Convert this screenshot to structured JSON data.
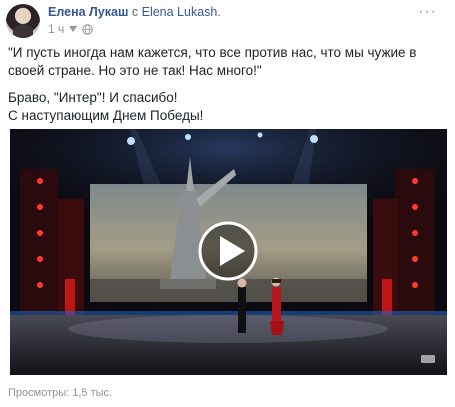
{
  "post": {
    "author": "Елена Лукаш",
    "with_word": "с",
    "tagged_user": "Elena Lukash",
    "time": "1 ч",
    "more": "···",
    "paragraph1": "\"И пусть иногда нам кажется, что все против нас, что мы чужие в своей стране. Но это не так! Нас много!\"",
    "paragraph2_line1": "Браво, \"Интер\"! И спасибо!",
    "paragraph2_line2": "С наступающим Днем Победы!",
    "views": "Просмотры: 1,5 тыс."
  },
  "icons": {
    "avatar": "avatar",
    "audience": "globe-icon",
    "menu": "ellipsis-icon",
    "play": "play-icon"
  },
  "colors": {
    "link": "#365899",
    "meta": "#90949c",
    "text": "#1d2129",
    "stage_red": "#c01616",
    "stage_blue": "#2d8fff"
  }
}
